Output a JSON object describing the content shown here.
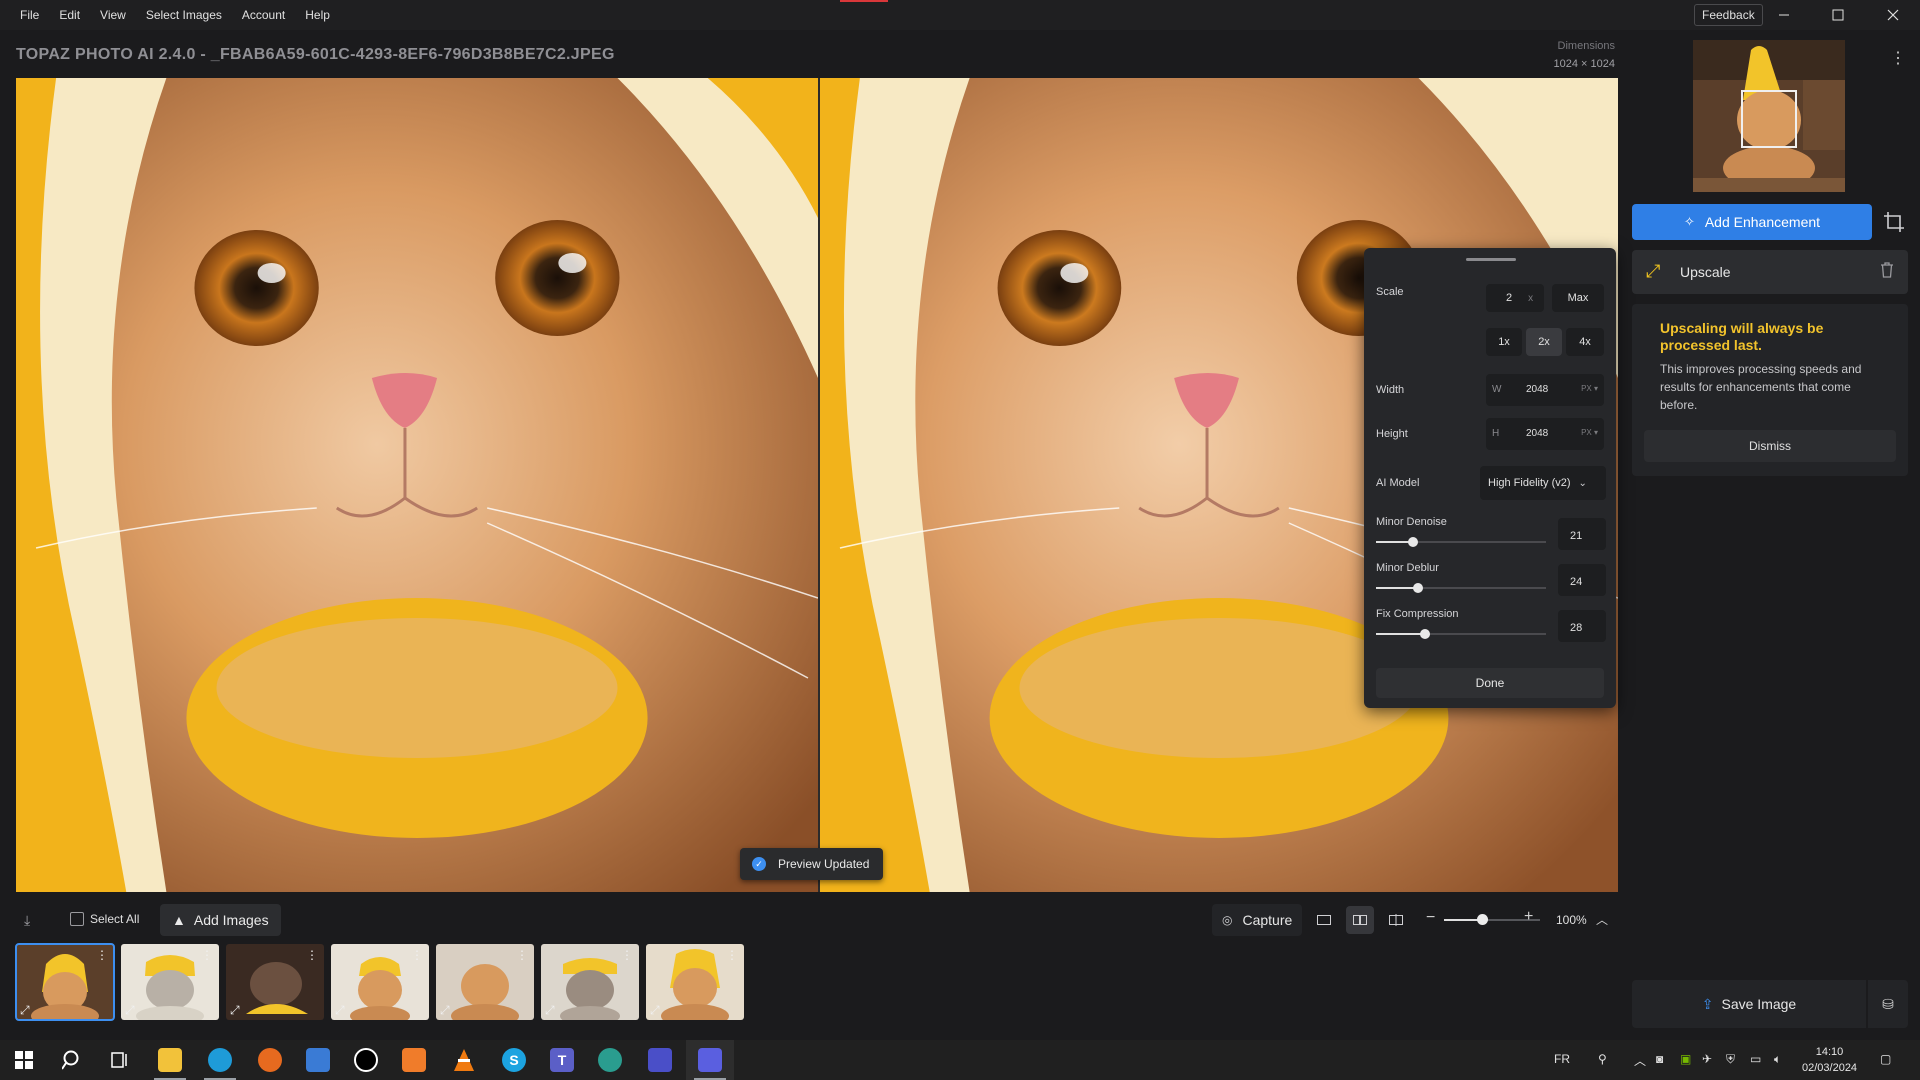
{
  "menu": [
    "File",
    "Edit",
    "View",
    "Select Images",
    "Account",
    "Help"
  ],
  "window": {
    "feedback": "Feedback",
    "title": "TOPAZ PHOTO AI 2.4.0 - _FBAB6A59-601C-4293-8EF6-796D3B8BE7C2.JPEG",
    "dimensions_label": "Dimensions",
    "dimensions_value": "1024 × 1024"
  },
  "preview": {
    "toast": "Preview Updated"
  },
  "upscale_panel": {
    "scale_label": "Scale",
    "scale_value": "2",
    "scale_x": "x",
    "max_label": "Max",
    "presets": [
      "1x",
      "2x",
      "4x"
    ],
    "selected_preset": "2x",
    "width_label": "Width",
    "width_prefix": "W",
    "width_value": "2048",
    "height_label": "Height",
    "height_prefix": "H",
    "height_value": "2048",
    "unit": "PX ▾",
    "model_label": "AI Model",
    "model_value": "High Fidelity (v2)",
    "sliders": [
      {
        "label": "Minor Denoise",
        "value": "21"
      },
      {
        "label": "Minor Deblur",
        "value": "24"
      },
      {
        "label": "Fix Compression",
        "value": "28"
      }
    ],
    "done": "Done"
  },
  "right_panel": {
    "add_enhancement": "Add Enhancement",
    "enhancement_name": "Upscale",
    "notice_title": "Upscaling will always be processed last.",
    "notice_body": "This improves processing speeds and results for enhancements that come before.",
    "dismiss": "Dismiss",
    "save_image": "Save Image"
  },
  "toolbar": {
    "select_all": "Select All",
    "add_images": "Add Images",
    "capture": "Capture",
    "zoom": "100%",
    "zoom_level": 0.5
  },
  "filmstrip": [
    {
      "name": "cat-banana-1",
      "active": true
    },
    {
      "name": "cat-banana-2",
      "active": false
    },
    {
      "name": "cat-banana-3",
      "active": false
    },
    {
      "name": "cat-banana-4",
      "active": false
    },
    {
      "name": "cat-banana-5",
      "active": false
    },
    {
      "name": "cat-banana-6",
      "active": false
    },
    {
      "name": "cat-banana-7",
      "active": false
    }
  ],
  "taskbar": {
    "language": "FR",
    "time": "14:10",
    "date": "02/03/2024"
  },
  "colors": {
    "accent": "#2f7fe6",
    "warning": "#f2c32c",
    "background": "#1b1b1d"
  }
}
